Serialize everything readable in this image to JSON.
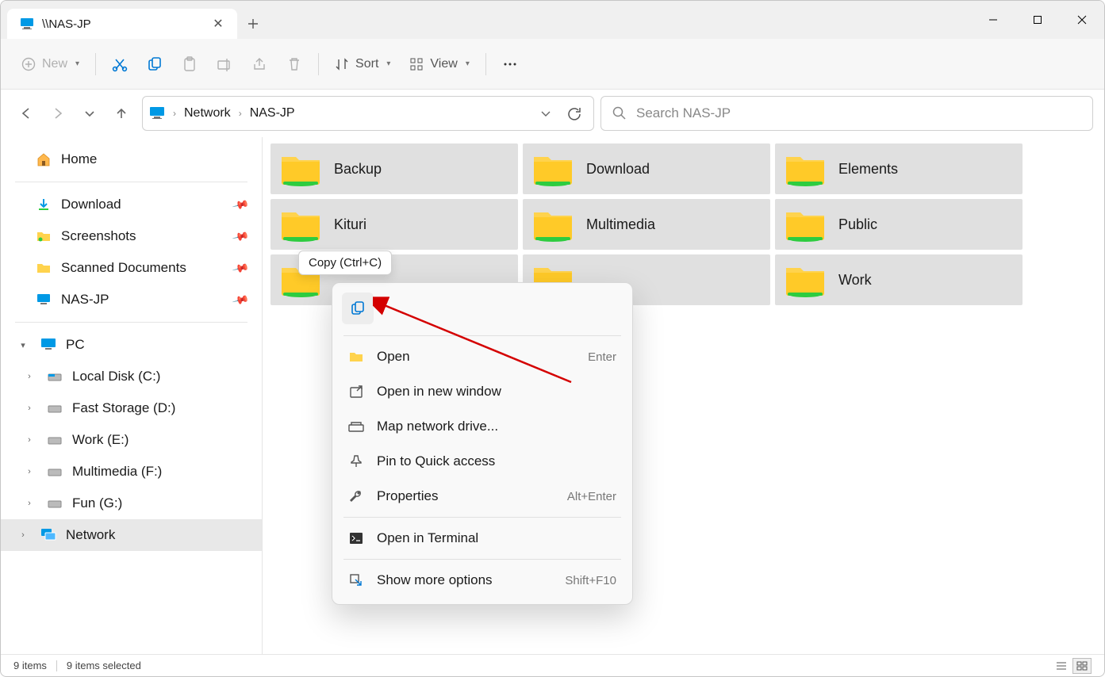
{
  "tab": {
    "title": "\\\\NAS-JP"
  },
  "toolbar": {
    "new_label": "New",
    "sort_label": "Sort",
    "view_label": "View"
  },
  "breadcrumb": {
    "network": "Network",
    "host": "NAS-JP"
  },
  "search": {
    "placeholder": "Search NAS-JP"
  },
  "sidebar": {
    "home": "Home",
    "quick": [
      {
        "label": "Download"
      },
      {
        "label": "Screenshots"
      },
      {
        "label": "Scanned Documents"
      },
      {
        "label": "NAS-JP"
      }
    ],
    "pc_label": "PC",
    "drives": [
      {
        "label": "Local Disk (C:)"
      },
      {
        "label": "Fast Storage (D:)"
      },
      {
        "label": "Work (E:)"
      },
      {
        "label": "Multimedia (F:)"
      },
      {
        "label": "Fun (G:)"
      }
    ],
    "network_label": "Network"
  },
  "folders": [
    {
      "name": "Backup"
    },
    {
      "name": "Download"
    },
    {
      "name": "Elements"
    },
    {
      "name": "Kituri"
    },
    {
      "name": "Multimedia"
    },
    {
      "name": "Public"
    },
    {
      "name": ""
    },
    {
      "name": ""
    },
    {
      "name": "Work"
    }
  ],
  "context_menu": {
    "tooltip": "Copy (Ctrl+C)",
    "items": [
      {
        "label": "Open",
        "shortcut": "Enter",
        "icon": "folder"
      },
      {
        "label": "Open in new window",
        "shortcut": "",
        "icon": "newwin"
      },
      {
        "label": "Map network drive...",
        "shortcut": "",
        "icon": "mapdrive"
      },
      {
        "label": "Pin to Quick access",
        "shortcut": "",
        "icon": "pin"
      },
      {
        "label": "Properties",
        "shortcut": "Alt+Enter",
        "icon": "wrench"
      }
    ],
    "terminal": {
      "label": "Open in Terminal"
    },
    "more": {
      "label": "Show more options",
      "shortcut": "Shift+F10"
    }
  },
  "status": {
    "items": "9 items",
    "selected": "9 items selected"
  }
}
